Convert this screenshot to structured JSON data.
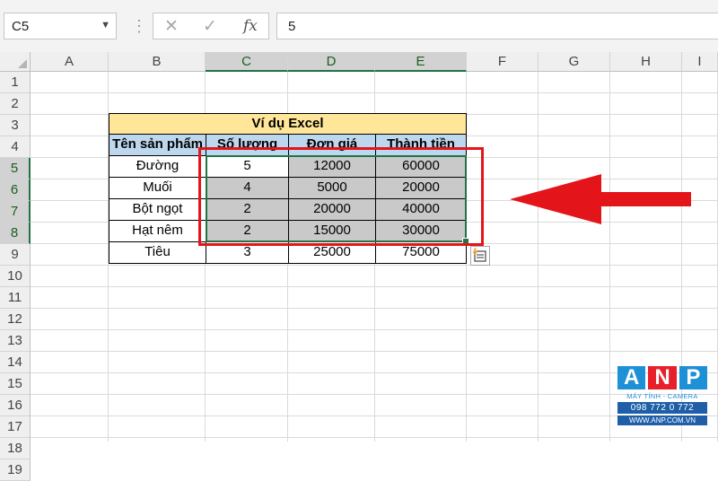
{
  "formula_bar": {
    "name_box": "C5",
    "name_box_dropdown_icon": "chevron-down-icon",
    "more_icon": "vertical-dots-icon",
    "cancel_icon": "close-icon",
    "enter_icon": "check-icon",
    "function_label": "fx",
    "value": "5"
  },
  "columns": [
    "A",
    "B",
    "C",
    "D",
    "E",
    "F",
    "G",
    "H",
    "I"
  ],
  "selected_columns": [
    "C",
    "D",
    "E"
  ],
  "rows": [
    "1",
    "2",
    "3",
    "4",
    "5",
    "6",
    "7",
    "8",
    "9",
    "10",
    "11",
    "12",
    "13",
    "14",
    "15",
    "16",
    "17",
    "18",
    "19"
  ],
  "selected_rows": [
    "5",
    "6",
    "7",
    "8"
  ],
  "table": {
    "title": "Ví dụ Excel",
    "headers": [
      "Tên sản phẩm",
      "Số lượng",
      "Đơn giá",
      "Thành tiền"
    ],
    "rows": [
      [
        "Đường",
        "5",
        "12000",
        "60000"
      ],
      [
        "Muối",
        "4",
        "5000",
        "20000"
      ],
      [
        "Bột ngọt",
        "2",
        "20000",
        "40000"
      ],
      [
        "Hạt nêm",
        "2",
        "15000",
        "30000"
      ],
      [
        "Tiêu",
        "3",
        "25000",
        "75000"
      ]
    ]
  },
  "quick_analysis_icon": "quick-analysis-icon",
  "colors": {
    "title_fill": "#ffe699",
    "header_fill": "#bdd7ee",
    "selection_fill": "#c9c9c9",
    "selection_border": "#217346",
    "annotation_red": "#e3151a"
  },
  "watermark": {
    "letters": [
      "A",
      "N",
      "P"
    ],
    "tagline": "MÁY TÍNH - CAMERA",
    "phone": "098 772 0 772",
    "website": "WWW.ANP.COM.VN"
  }
}
